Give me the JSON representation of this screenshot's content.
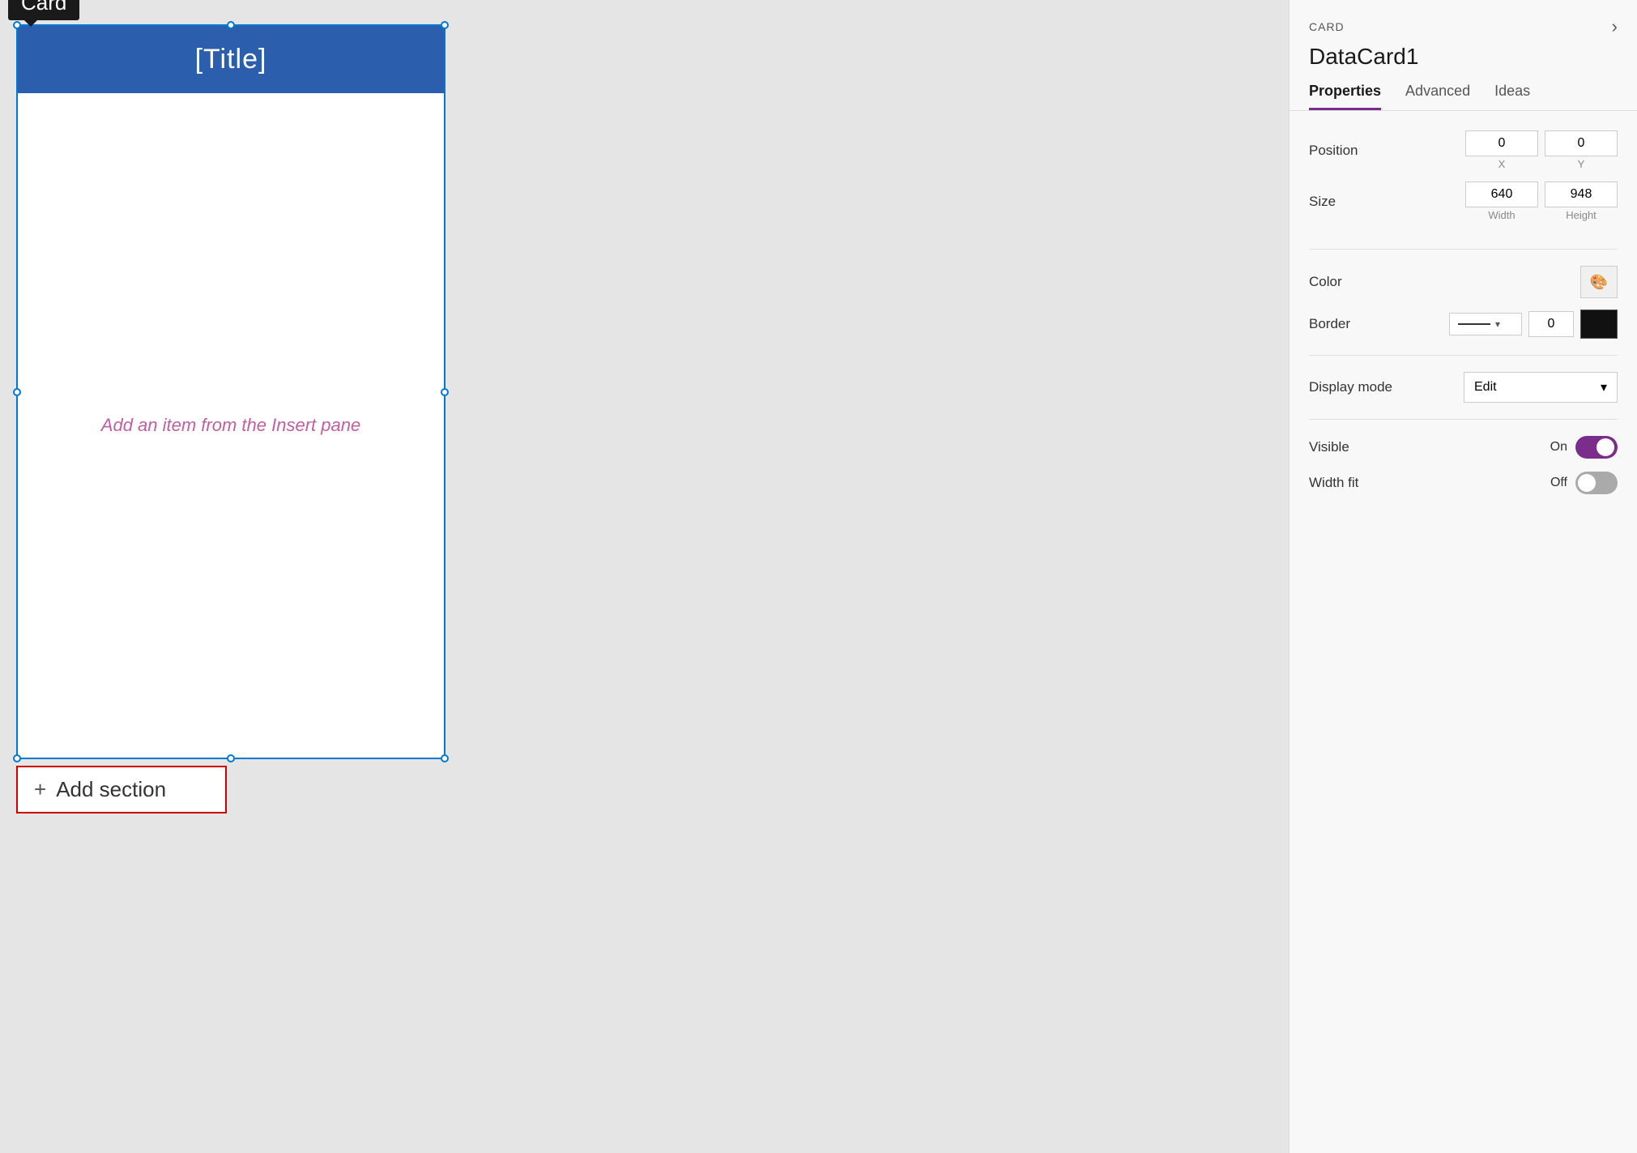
{
  "canvas": {
    "card_label": "Card",
    "card_title": "[Title]",
    "card_placeholder": "Add an item from the Insert pane",
    "add_section_label": "Add section"
  },
  "panel": {
    "card_type_label": "CARD",
    "title": "DataCard1",
    "close_icon": "›",
    "tabs": [
      {
        "id": "properties",
        "label": "Properties",
        "active": true
      },
      {
        "id": "advanced",
        "label": "Advanced",
        "active": false
      },
      {
        "id": "ideas",
        "label": "Ideas",
        "active": false
      }
    ],
    "properties": {
      "position_label": "Position",
      "position_x": "0",
      "position_x_sublabel": "X",
      "position_y": "0",
      "position_y_sublabel": "Y",
      "size_label": "Size",
      "size_width": "640",
      "size_width_sublabel": "Width",
      "size_height": "948",
      "size_height_sublabel": "Height",
      "color_label": "Color",
      "color_icon": "🎨",
      "border_label": "Border",
      "border_value": "0",
      "display_mode_label": "Display mode",
      "display_mode_value": "Edit",
      "visible_label": "Visible",
      "visible_toggle_label": "On",
      "visible_state": "on",
      "width_fit_label": "Width fit",
      "width_fit_toggle_label": "Off",
      "width_fit_state": "off"
    }
  },
  "colors": {
    "accent_purple": "#7b2d8b",
    "card_header_blue": "#2b5fad",
    "selection_blue": "#0078d4"
  }
}
